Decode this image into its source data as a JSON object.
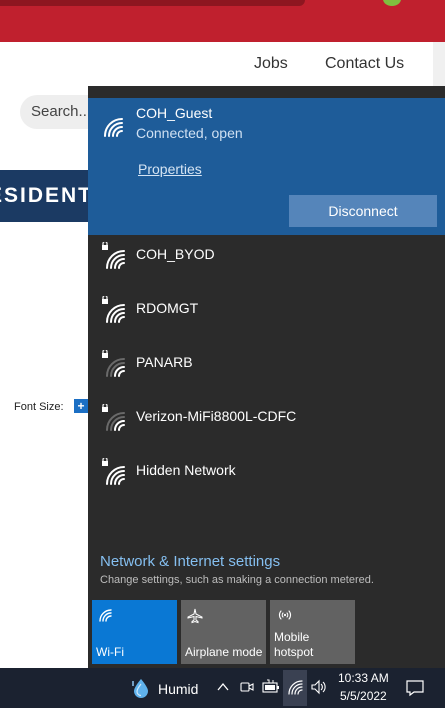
{
  "webpage": {
    "nav": {
      "jobs": "Jobs",
      "contact": "Contact Us"
    },
    "search_placeholder": "Search...",
    "banner_text": "ESIDENT",
    "font_size_label": "Font Size:",
    "font_size_increase": "+"
  },
  "flyout": {
    "connected": {
      "ssid": "COH_Guest",
      "status": "Connected, open",
      "properties_label": "Properties",
      "disconnect_label": "Disconnect",
      "icon": "wifi-icon"
    },
    "networks": [
      {
        "ssid": "COH_BYOD",
        "secured": true,
        "signal": 4
      },
      {
        "ssid": "RDOMGT",
        "secured": true,
        "signal": 4
      },
      {
        "ssid": "PANARB",
        "secured": true,
        "signal": 2
      },
      {
        "ssid": "Verizon-MiFi8800L-CDFC",
        "secured": true,
        "signal": 2
      },
      {
        "ssid": "Hidden Network",
        "secured": true,
        "signal": 4
      }
    ],
    "settings_link": "Network & Internet settings",
    "settings_desc": "Change settings, such as making a connection metered.",
    "quick_actions": [
      {
        "label": "Wi-Fi",
        "icon": "wifi-icon",
        "active": true
      },
      {
        "label": "Airplane mode",
        "icon": "airplane-icon",
        "active": false
      },
      {
        "label": "Mobile hotspot",
        "icon": "hotspot-icon",
        "active": false
      }
    ]
  },
  "taskbar": {
    "weather": "Humid",
    "time": "10:33 AM",
    "date": "5/5/2022"
  },
  "colors": {
    "flyout_bg": "#2b2b2b",
    "connected_bg": "#1e5c99",
    "accent": "#0a78d4",
    "taskbar_bg": "#1b2230"
  }
}
